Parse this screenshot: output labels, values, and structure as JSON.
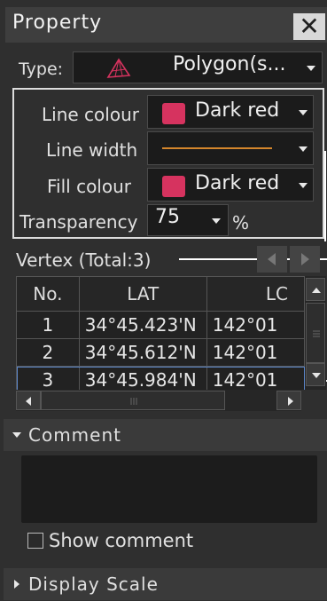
{
  "window": {
    "title": "Property"
  },
  "type_row": {
    "label": "Type:",
    "value": "Polygon(s...",
    "icon": "polygon-icon"
  },
  "line_colour": {
    "label": "Line colour",
    "value": "Dark red",
    "swatch": "#d6335f"
  },
  "line_width": {
    "label": "Line width",
    "sample_color": "#d4862c"
  },
  "fill_colour": {
    "label": "Fill colour",
    "value": "Dark red",
    "swatch": "#d6335f"
  },
  "transparency": {
    "label": "Transparency",
    "value": "75",
    "unit": "%"
  },
  "vertex": {
    "title": "Vertex (Total:3)",
    "columns": [
      "No.",
      "LAT",
      "LC"
    ],
    "rows": [
      {
        "no": "1",
        "lat": "34°45.423'N",
        "lon": "142°01"
      },
      {
        "no": "2",
        "lat": "34°45.612'N",
        "lon": "142°01"
      },
      {
        "no": "3",
        "lat": "34°45.984'N",
        "lon": "142°01"
      }
    ]
  },
  "comment": {
    "section_label": "Comment",
    "show_label": "Show comment"
  },
  "display_scale": {
    "section_label": "Display Scale"
  }
}
